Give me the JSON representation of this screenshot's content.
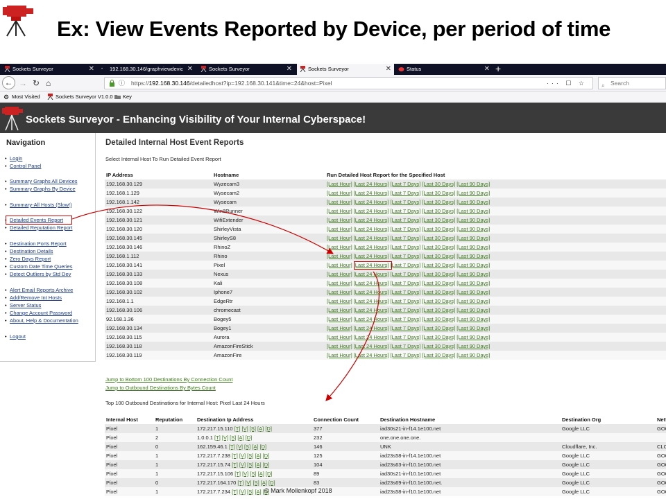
{
  "slide": {
    "title": "Ex: View Events Reported by Device, per period of time",
    "copyright": "© Mark Mollenkopf 2018"
  },
  "browser": {
    "tabs": [
      {
        "label": "Sockets Surveyor",
        "active": false
      },
      {
        "label": "192.168.30.146/graphviewdevic",
        "active": false
      },
      {
        "label": "Sockets Surveyor",
        "active": false
      },
      {
        "label": "Sockets Surveyor",
        "active": true
      },
      {
        "label": "Status",
        "active": false
      }
    ],
    "url_prefix": "https://",
    "url_host": "192.168.30.146",
    "url_path": "/detailedhost?ip=192.168.30.141&time=24&host=Pixel",
    "url_actions": "··· ☐ ☆",
    "search_placeholder": "Search",
    "bookmarks": [
      "Most Visited",
      "Sockets Surveyor V1.0.0",
      "Key"
    ]
  },
  "site": {
    "title": "Sockets Surveyor - Enhancing Visibility of Your Internal Cyberspace!"
  },
  "nav": {
    "heading": "Navigation",
    "items": [
      "Login",
      "Control Panel",
      "Summary Graphs All Devices",
      "Summary Graphs By Device",
      "Summary-All Hosts (Slow!)",
      "Detailed Events Report",
      "Detailed Reputation Report",
      "Destination Ports Report",
      "Destination Details",
      "Zero Days Report",
      "Custom Date Time Queries",
      "Detect Outliers by Std Dev",
      "Alert Email Reports Archive",
      "Add/Remove Int Hosts",
      "Server Status",
      "Change Account Password",
      "About, Help & Documentation",
      "Logout"
    ]
  },
  "main": {
    "title": "Detailed Internal Host Event Reports",
    "subtitle": "Select Internal Host To Run Detailed Event Report",
    "hosts_headers": [
      "IP Address",
      "Hostname",
      "Run Detailed Host Report for the Specified Host"
    ],
    "report_links": [
      "[Last Hour]",
      "[Last 24 Hours]",
      "[Last 7 Days]",
      "[Last 30 Days]",
      "[Last 90 Days]"
    ],
    "hosts": [
      {
        "ip": "192.168.30.129",
        "host": "Wyzecam3"
      },
      {
        "ip": "192.168.1.129",
        "host": "Wysecam2"
      },
      {
        "ip": "192.168.1.142",
        "host": "Wysecam"
      },
      {
        "ip": "192.168.30.122",
        "host": "Win8Runner"
      },
      {
        "ip": "192.168.30.121",
        "host": "WifiExtender"
      },
      {
        "ip": "192.168.30.120",
        "host": "ShirleyVista"
      },
      {
        "ip": "192.168.30.145",
        "host": "ShirleyS8"
      },
      {
        "ip": "192.168.30.146",
        "host": "RhinoZ"
      },
      {
        "ip": "192.168.1.112",
        "host": "Rhino"
      },
      {
        "ip": "192.168.30.141",
        "host": "Pixel"
      },
      {
        "ip": "192.168.30.133",
        "host": "Nexus"
      },
      {
        "ip": "192.168.30.108",
        "host": "Kali"
      },
      {
        "ip": "192.168.30.102",
        "host": "Iphone7"
      },
      {
        "ip": "192.168.1.1",
        "host": "EdgeRtr"
      },
      {
        "ip": "192.168.30.106",
        "host": "chromecast"
      },
      {
        "ip": "92.168.1.36",
        "host": "Bogey5"
      },
      {
        "ip": "192.168.30.134",
        "host": "Bogey1"
      },
      {
        "ip": "192.168.30.115",
        "host": "Aurora"
      },
      {
        "ip": "192.168.30.118",
        "host": "AmazonFireStick"
      },
      {
        "ip": "192.168.30.119",
        "host": "AmazonFire"
      }
    ],
    "jump_links": [
      "Jump to Bottom 100 Destinations By Connection Count",
      "Jump to Outbound Destinations By Bytes Count"
    ],
    "top_dest_title": "Top 100 Outbound Destinations for Internal Host: Pixel Last 24 Hours",
    "dest_headers": [
      "Internal Host",
      "Reputation",
      "Destination Ip Address",
      "Connection Count",
      "Destination Hostname",
      "Destination Org",
      "Netf"
    ],
    "dest_links": [
      "[T]",
      "[V]",
      "[S]",
      "[A]",
      "[D]"
    ],
    "destinations": [
      {
        "host": "Pixel",
        "rep": "1",
        "ip": "172.217.15.110",
        "count": "377",
        "hostname": "iad30s21-in-f14.1e100.net",
        "org": "Google LLC",
        "net": "GOO"
      },
      {
        "host": "Pixel",
        "rep": "2",
        "ip": "1.0.0.1",
        "count": "232",
        "hostname": "one.one.one.one.",
        "org": "",
        "net": ""
      },
      {
        "host": "Pixel",
        "rep": "0",
        "ip": "162.159.46.1",
        "count": "146",
        "hostname": "UNK",
        "org": "Cloudflare, Inc.",
        "net": "CLO"
      },
      {
        "host": "Pixel",
        "rep": "1",
        "ip": "172.217.7.238",
        "count": "125",
        "hostname": "iad23s58-in-f14.1e100.net",
        "org": "Google LLC",
        "net": "GOO"
      },
      {
        "host": "Pixel",
        "rep": "1",
        "ip": "172.217.15.74",
        "count": "104",
        "hostname": "iad23s63-in-f10.1e100.net",
        "org": "Google LLC",
        "net": "GOO"
      },
      {
        "host": "Pixel",
        "rep": "1",
        "ip": "172.217.15.106",
        "count": "89",
        "hostname": "iad30s21-in-f10.1e100.net",
        "org": "Google LLC",
        "net": "GOO"
      },
      {
        "host": "Pixel",
        "rep": "0",
        "ip": "172.217.164.170",
        "count": "83",
        "hostname": "iad23s69-in-f10.1e100.net.",
        "org": "Google LLC",
        "net": "GOO"
      },
      {
        "host": "Pixel",
        "rep": "1",
        "ip": "172.217.7.234",
        "count": "",
        "hostname": "iad23s58-in-f10.1e100.net",
        "org": "Google LLC",
        "net": "GOO"
      }
    ]
  },
  "colors": {
    "header_bg": "#3a3a3a",
    "tabbar_bg": "#0f1126",
    "report_link": "#3d7a1c",
    "nav_link": "#1a3a8a",
    "annotation": "#c00000"
  },
  "icons": [
    "tripod-logo-icon",
    "back-icon",
    "forward-icon",
    "reload-icon",
    "home-icon",
    "lock-icon",
    "search-icon",
    "star-icon",
    "folder-icon"
  ]
}
